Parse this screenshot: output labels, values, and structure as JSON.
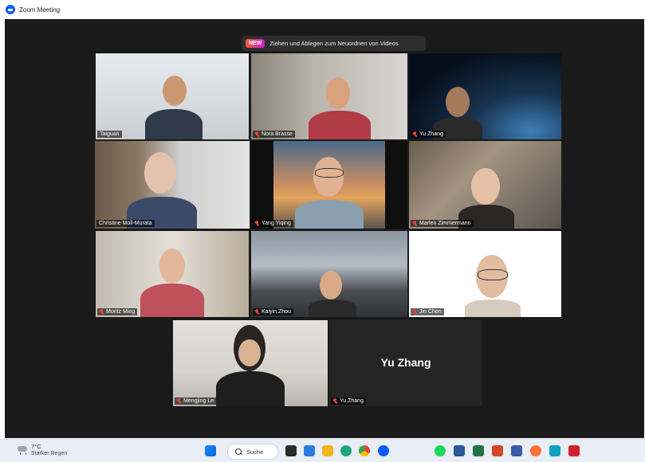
{
  "window": {
    "title": "Zoom Meeting"
  },
  "banner": {
    "badge": "NEW",
    "text": "Ziehen und Ablegen zum Neuordnen von Videos"
  },
  "participants": [
    {
      "name": "Taiguan",
      "muted": false
    },
    {
      "name": "Nora Brasse",
      "muted": true
    },
    {
      "name": "Yu Zhang",
      "muted": true
    },
    {
      "name": "Christine Moll-Murata",
      "muted": false,
      "speaking": true
    },
    {
      "name": "Yang Yiqing",
      "muted": true
    },
    {
      "name": "Marlen Zimmermann",
      "muted": true
    },
    {
      "name": "Moritz Mieg",
      "muted": true
    },
    {
      "name": "Kaiyin Zhou",
      "muted": true
    },
    {
      "name": "Jin Chen",
      "muted": true
    },
    {
      "name": "Mengjing Le",
      "muted": true
    },
    {
      "name": "Yu Zhang",
      "muted": true,
      "video_off": true,
      "display_name": "Yu Zhang"
    }
  ],
  "taskbar": {
    "weather_temp": "7°C",
    "weather_condition": "Starker Regen",
    "search_label": "Suche",
    "icons": [
      "windows-start",
      "task-view",
      "mail",
      "file-explorer",
      "edge",
      "chrome",
      "zoom",
      "spotify",
      "word",
      "excel",
      "powerpoint",
      "calculator",
      "firefox",
      "webex",
      "app"
    ]
  },
  "colors": {
    "meeting_bg": "#1a1a1a",
    "speaker_border": "#b7d43a",
    "muted_mic": "#e0463b",
    "zoom_blue": "#0b5cff"
  }
}
